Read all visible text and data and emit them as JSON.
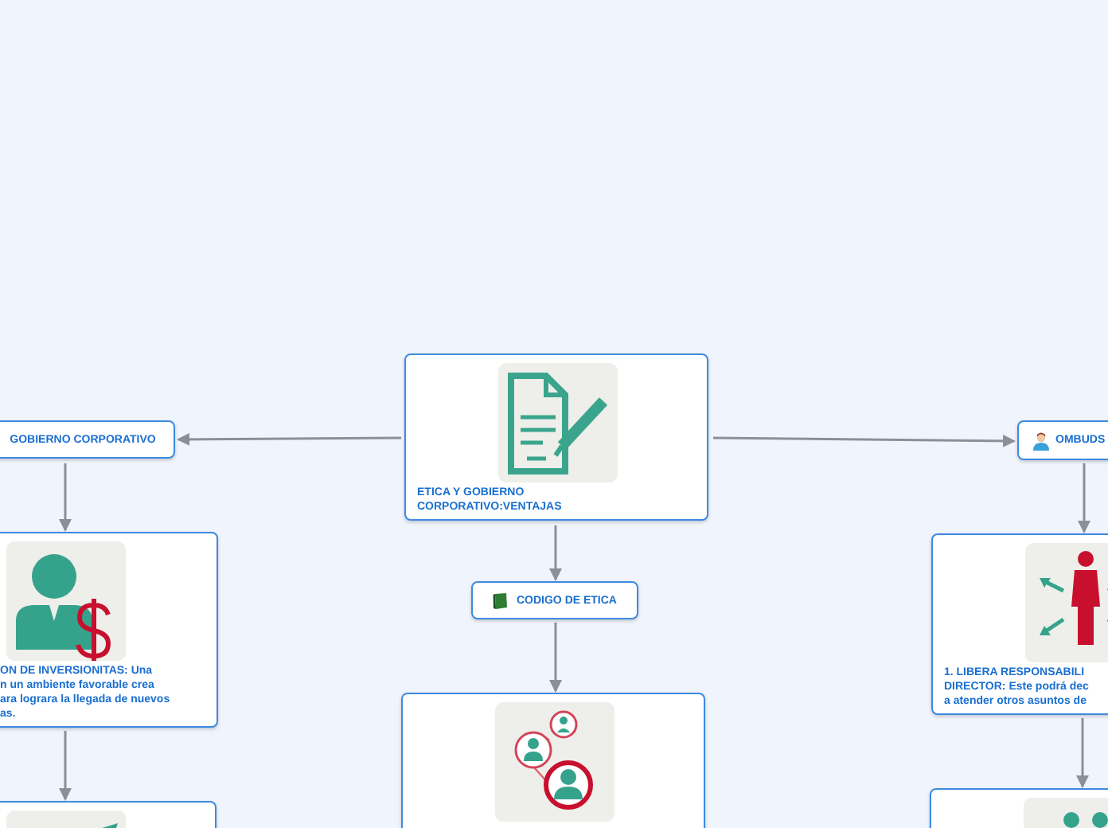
{
  "mind_map": {
    "root": {
      "kind": "card",
      "text": "ETICA Y GOBIERNO\nCORPORATIVO:VENTAJAS",
      "children": [
        {
          "kind": "topic",
          "text": "GOBIERNO CORPORATIVO",
          "children": [
            {
              "kind": "card",
              "text": "ON DE INVERSIONITAS: Una\nn un ambiente favorable crea\nara lograra la llegada de nuevos\nas.",
              "children": [
                {
                  "kind": "card"
                }
              ]
            }
          ]
        },
        {
          "kind": "topic",
          "text": "CODIGO DE ETICA",
          "children": [
            {
              "kind": "card"
            }
          ]
        },
        {
          "kind": "topic",
          "text": "OMBUDS",
          "children": [
            {
              "kind": "card",
              "text": "1. LIBERA RESPONSABILI\nDIRECTOR: Este podrá dec\na atender otros asuntos de",
              "children": [
                {
                  "kind": "card"
                }
              ]
            }
          ]
        }
      ]
    }
  }
}
